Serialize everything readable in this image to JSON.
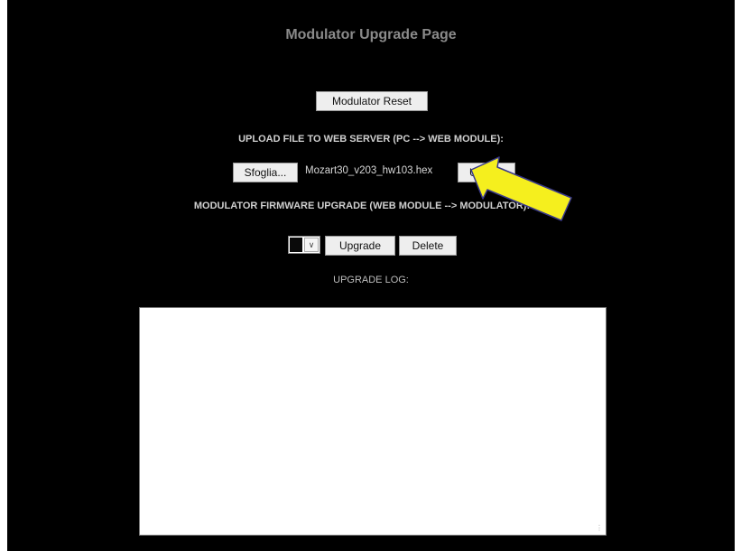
{
  "page": {
    "title": "Modulator Upgrade Page"
  },
  "reset": {
    "button_label": "Modulator Reset"
  },
  "upload": {
    "heading": "UPLOAD FILE TO WEB SERVER (PC --> WEB MODULE):",
    "browse_label": "Sfoglia...",
    "selected_file": "Mozart30_v203_hw103.hex",
    "upload_label": "Upload"
  },
  "firmware": {
    "heading": "MODULATOR FIRMWARE UPGRADE (WEB MODULE --> MODULATOR):",
    "selected_value": "",
    "upgrade_label": "Upgrade",
    "delete_label": "Delete"
  },
  "log": {
    "heading": "UPGRADE LOG:",
    "content": ""
  },
  "colors": {
    "background": "#000000",
    "annotation_arrow": "#f5ef1e"
  },
  "icons": {
    "dropdown": "chevron-down-icon",
    "annotation": "yellow-arrow-icon",
    "resize": "resize-grip-icon"
  }
}
